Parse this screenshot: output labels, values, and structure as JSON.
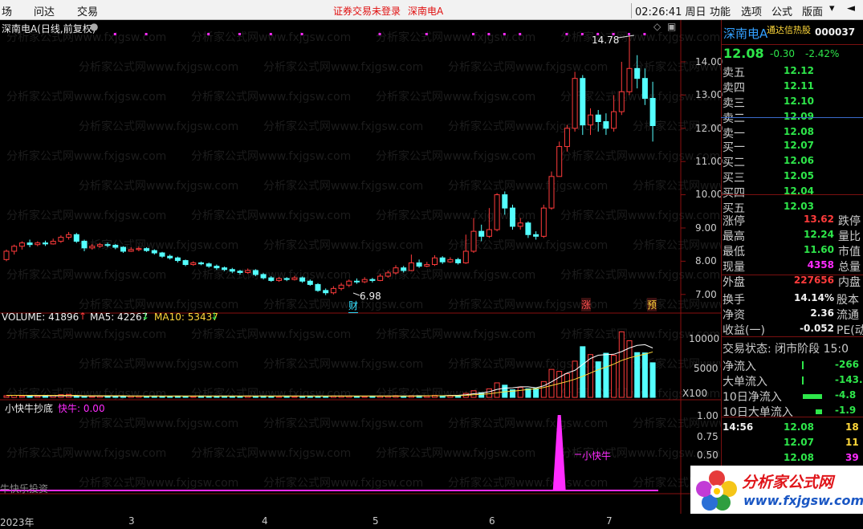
{
  "menu": {
    "left_items": [
      "场",
      "问达",
      "交易"
    ],
    "notice": "证券交易未登录",
    "stock": "深南电A",
    "clock": "02:26:41 周日",
    "right_items": [
      "功能",
      "选项",
      "公式",
      "版面"
    ],
    "win_controls": [
      "▾",
      "◄"
    ]
  },
  "chart": {
    "title": "深南电A(日线,前复权)",
    "high_label": "14.78",
    "low_label": "6.98",
    "marker_cai": "财",
    "marker_zhang": "涨",
    "marker_yu": "预",
    "price_ticks": [
      "14.00",
      "13.00",
      "12.00",
      "11.00",
      "10.00",
      "9.00",
      "8.00",
      "7.00"
    ],
    "volume_header": {
      "label": "VOLUME: 41896",
      "ma5": "MA5: 42267",
      "ma10": "MA10: 53437"
    },
    "volume_ticks": [
      "10000",
      "5000",
      "X100"
    ],
    "indicator_header": {
      "name": "小快牛抄底",
      "value": "快牛: 0.00"
    },
    "indicator_ticks": [
      "1.00",
      "0.75",
      "0.50"
    ],
    "indicator_signal": "小快牛",
    "indicator_footer": "牛快乐投资",
    "date_ticks": [
      "2023年",
      "3",
      "4",
      "5",
      "6",
      "7"
    ],
    "watermark": "分析家公式网www.fxjgsw.com"
  },
  "chart_data": {
    "type": "candlestick",
    "title": "深南电A(日线,前复权)",
    "ylim": [
      6.7,
      14.9
    ],
    "candles": [
      [
        8.05,
        8.3,
        8.35,
        8.0
      ],
      [
        8.3,
        8.45,
        8.5,
        8.2
      ],
      [
        8.45,
        8.55,
        8.6,
        8.35
      ],
      [
        8.55,
        8.5,
        8.65,
        8.42
      ],
      [
        8.5,
        8.55,
        8.6,
        8.45
      ],
      [
        8.55,
        8.52,
        8.62,
        8.46
      ],
      [
        8.52,
        8.6,
        8.68,
        8.5
      ],
      [
        8.6,
        8.72,
        8.78,
        8.55
      ],
      [
        8.72,
        8.8,
        8.88,
        8.65
      ],
      [
        8.8,
        8.6,
        8.85,
        8.55
      ],
      [
        8.6,
        8.4,
        8.65,
        8.3
      ],
      [
        8.4,
        8.45,
        8.52,
        8.35
      ],
      [
        8.45,
        8.5,
        8.55,
        8.4
      ],
      [
        8.5,
        8.48,
        8.56,
        8.42
      ],
      [
        8.48,
        8.42,
        8.52,
        8.36
      ],
      [
        8.42,
        8.3,
        8.45,
        8.25
      ],
      [
        8.3,
        8.35,
        8.42,
        8.28
      ],
      [
        8.35,
        8.38,
        8.44,
        8.3
      ],
      [
        8.38,
        8.32,
        8.42,
        8.28
      ],
      [
        8.32,
        8.25,
        8.36,
        8.2
      ],
      [
        8.25,
        8.15,
        8.28,
        8.1
      ],
      [
        8.15,
        8.1,
        8.2,
        8.05
      ],
      [
        8.1,
        8.02,
        8.14,
        7.96
      ],
      [
        8.02,
        7.9,
        8.05,
        7.85
      ],
      [
        7.9,
        7.95,
        8.0,
        7.86
      ],
      [
        7.95,
        7.92,
        7.99,
        7.88
      ],
      [
        7.92,
        7.85,
        7.96,
        7.8
      ],
      [
        7.85,
        7.8,
        7.9,
        7.74
      ],
      [
        7.8,
        7.75,
        7.84,
        7.7
      ],
      [
        7.75,
        7.7,
        7.8,
        7.64
      ],
      [
        7.7,
        7.66,
        7.74,
        7.6
      ],
      [
        7.66,
        7.72,
        7.78,
        7.62
      ],
      [
        7.72,
        7.6,
        7.76,
        7.55
      ],
      [
        7.6,
        7.5,
        7.64,
        7.45
      ],
      [
        7.5,
        7.42,
        7.55,
        7.38
      ],
      [
        7.42,
        7.48,
        7.52,
        7.38
      ],
      [
        7.48,
        7.45,
        7.52,
        7.4
      ],
      [
        7.45,
        7.5,
        7.56,
        7.42
      ],
      [
        7.5,
        7.4,
        7.54,
        7.35
      ],
      [
        7.4,
        7.3,
        7.45,
        7.26
      ],
      [
        7.3,
        7.12,
        7.34,
        7.08
      ],
      [
        7.12,
        7.05,
        7.18,
        6.98
      ],
      [
        7.05,
        7.18,
        7.25,
        7.0
      ],
      [
        7.18,
        7.28,
        7.35,
        7.12
      ],
      [
        7.28,
        7.4,
        7.45,
        7.22
      ],
      [
        7.4,
        7.38,
        7.48,
        7.32
      ],
      [
        7.38,
        7.45,
        7.52,
        7.34
      ],
      [
        7.45,
        7.42,
        7.5,
        7.36
      ],
      [
        7.42,
        7.55,
        7.62,
        7.4
      ],
      [
        7.55,
        7.65,
        7.72,
        7.5
      ],
      [
        7.65,
        7.8,
        7.88,
        7.6
      ],
      [
        7.8,
        7.72,
        7.86,
        7.66
      ],
      [
        7.72,
        7.95,
        8.2,
        7.7
      ],
      [
        7.95,
        7.85,
        8.05,
        7.8
      ],
      [
        7.85,
        7.9,
        7.98,
        7.82
      ],
      [
        7.9,
        8.1,
        8.18,
        7.86
      ],
      [
        8.1,
        7.98,
        8.15,
        7.92
      ],
      [
        7.98,
        8.05,
        8.12,
        7.95
      ],
      [
        8.05,
        7.95,
        8.1,
        7.9
      ],
      [
        7.95,
        8.3,
        8.8,
        7.92
      ],
      [
        8.3,
        8.9,
        9.3,
        8.25
      ],
      [
        8.9,
        8.75,
        9.1,
        8.6
      ],
      [
        8.75,
        8.95,
        9.6,
        8.7
      ],
      [
        8.95,
        10.0,
        10.05,
        8.9
      ],
      [
        10.0,
        9.6,
        10.1,
        9.4
      ],
      [
        9.6,
        9.05,
        9.7,
        8.95
      ],
      [
        9.05,
        9.15,
        9.3,
        8.95
      ],
      [
        9.15,
        8.8,
        9.2,
        8.7
      ],
      [
        8.8,
        8.75,
        8.9,
        8.65
      ],
      [
        8.75,
        9.6,
        9.7,
        8.7
      ],
      [
        9.6,
        10.55,
        10.7,
        9.55
      ],
      [
        10.55,
        11.45,
        11.6,
        11.15
      ],
      [
        11.45,
        12.0,
        12.1,
        11.3
      ],
      [
        12.0,
        13.5,
        13.7,
        11.9
      ],
      [
        13.5,
        12.1,
        13.6,
        11.8
      ],
      [
        12.1,
        12.4,
        12.6,
        11.8
      ],
      [
        12.4,
        12.2,
        12.55,
        11.9
      ],
      [
        12.2,
        12.0,
        12.45,
        11.8
      ],
      [
        12.0,
        12.5,
        13.0,
        11.9
      ],
      [
        12.5,
        13.1,
        14.0,
        12.4
      ],
      [
        13.1,
        13.8,
        14.78,
        13.0
      ],
      [
        13.8,
        13.5,
        14.2,
        13.2
      ],
      [
        13.5,
        12.9,
        13.8,
        12.7
      ],
      [
        12.9,
        12.08,
        13.4,
        11.6
      ]
    ],
    "volume": [
      5,
      6,
      4,
      5,
      4,
      6,
      5,
      8,
      9,
      4,
      3,
      3,
      4,
      5,
      3,
      3,
      4,
      4,
      3,
      4,
      3,
      3,
      4,
      3,
      3,
      4,
      3,
      3,
      4,
      3,
      3,
      4,
      3,
      4,
      3,
      3,
      4,
      3,
      3,
      4,
      3,
      3,
      4,
      4,
      4,
      3,
      3,
      4,
      4,
      4,
      5,
      4,
      5,
      5,
      4,
      6,
      5,
      6,
      5,
      12,
      20,
      14,
      26,
      44,
      37,
      23,
      30,
      26,
      27,
      48,
      85,
      79,
      72,
      110,
      154,
      130,
      108,
      134,
      128,
      199,
      172,
      136,
      135,
      105
    ],
    "ma5": [
      6,
      6,
      6,
      5,
      5,
      5,
      5,
      5,
      5,
      5,
      4,
      4,
      4,
      4,
      4,
      4,
      4,
      4,
      4,
      4,
      4,
      4,
      4,
      4,
      4,
      4,
      4,
      4,
      4,
      4,
      4,
      4,
      4,
      4,
      4,
      4,
      4,
      4,
      4,
      4,
      4,
      4,
      4,
      4,
      4,
      4,
      4,
      4,
      4,
      4,
      4,
      4,
      4,
      5,
      5,
      5,
      5,
      6,
      6,
      8,
      11,
      13,
      17,
      24,
      28,
      29,
      32,
      32,
      29,
      35,
      47,
      61,
      74,
      82,
      100,
      118,
      128,
      130,
      131,
      139,
      150,
      158,
      160,
      150
    ],
    "ma10": [
      6,
      6,
      6,
      6,
      6,
      6,
      6,
      6,
      6,
      6,
      5,
      5,
      5,
      5,
      5,
      5,
      4,
      4,
      4,
      4,
      4,
      4,
      4,
      4,
      4,
      4,
      4,
      4,
      4,
      4,
      4,
      4,
      4,
      4,
      4,
      4,
      4,
      4,
      4,
      4,
      4,
      4,
      4,
      4,
      4,
      4,
      4,
      4,
      4,
      4,
      4,
      4,
      4,
      4,
      5,
      5,
      5,
      5,
      5,
      6,
      8,
      9,
      11,
      14,
      17,
      19,
      21,
      24,
      26,
      30,
      36,
      42,
      48,
      55,
      64,
      74,
      84,
      92,
      101,
      112,
      120,
      126,
      131,
      138
    ],
    "indicator_spike_index": 71
  },
  "quote": {
    "name": "深南电A",
    "subtitle": "通达信热股",
    "code": "000037",
    "price": "12.08",
    "change": "-0.30",
    "change_pct": "-2.42%",
    "asks": [
      {
        "label": "卖五",
        "price": "12.12"
      },
      {
        "label": "卖四",
        "price": "12.11"
      },
      {
        "label": "卖三",
        "price": "12.10"
      },
      {
        "label": "卖二",
        "price": "12.09"
      },
      {
        "label": "卖一",
        "price": "12.08"
      }
    ],
    "bids": [
      {
        "label": "买一",
        "price": "12.07"
      },
      {
        "label": "买二",
        "price": "12.06"
      },
      {
        "label": "买三",
        "price": "12.05"
      },
      {
        "label": "买四",
        "price": "12.04"
      },
      {
        "label": "买五",
        "price": "12.03"
      }
    ],
    "stats": [
      {
        "label": "涨停",
        "value": "13.62",
        "right": "跌停",
        "cls": "red"
      },
      {
        "label": "最高",
        "value": "12.24",
        "right": "量比",
        "cls": "green"
      },
      {
        "label": "最低",
        "value": "11.60",
        "right": "市值",
        "cls": "green"
      },
      {
        "label": "现量",
        "value": "4358",
        "right": "总量",
        "cls": "magenta"
      },
      {
        "label": "外盘",
        "value": "227656",
        "right": "内盘",
        "cls": "red"
      }
    ],
    "stats2": [
      {
        "label": "换手",
        "value": "14.14%",
        "right": "股本"
      },
      {
        "label": "净资",
        "value": "2.36",
        "right": "流通"
      },
      {
        "label": "收益(一)",
        "value": "-0.052",
        "right": "PE(动)"
      }
    ],
    "trade_status": "交易状态: 闭市阶段 15:0",
    "flows": [
      {
        "label": "净流入",
        "value": "-266"
      },
      {
        "label": "大单流入",
        "value": "-143."
      },
      {
        "label": "10日净流入",
        "value": "-4.8"
      },
      {
        "label": "10日大单流入",
        "value": "-1.9"
      }
    ],
    "ticks": [
      {
        "time": "14:56",
        "price": "12.08",
        "vol": "18"
      },
      {
        "time": "",
        "price": "12.07",
        "vol": "11"
      },
      {
        "time": "",
        "price": "12.08",
        "vol": "39"
      }
    ],
    "logo_text": "分析家公式网",
    "logo_url": "www.fxjgsw.com"
  }
}
